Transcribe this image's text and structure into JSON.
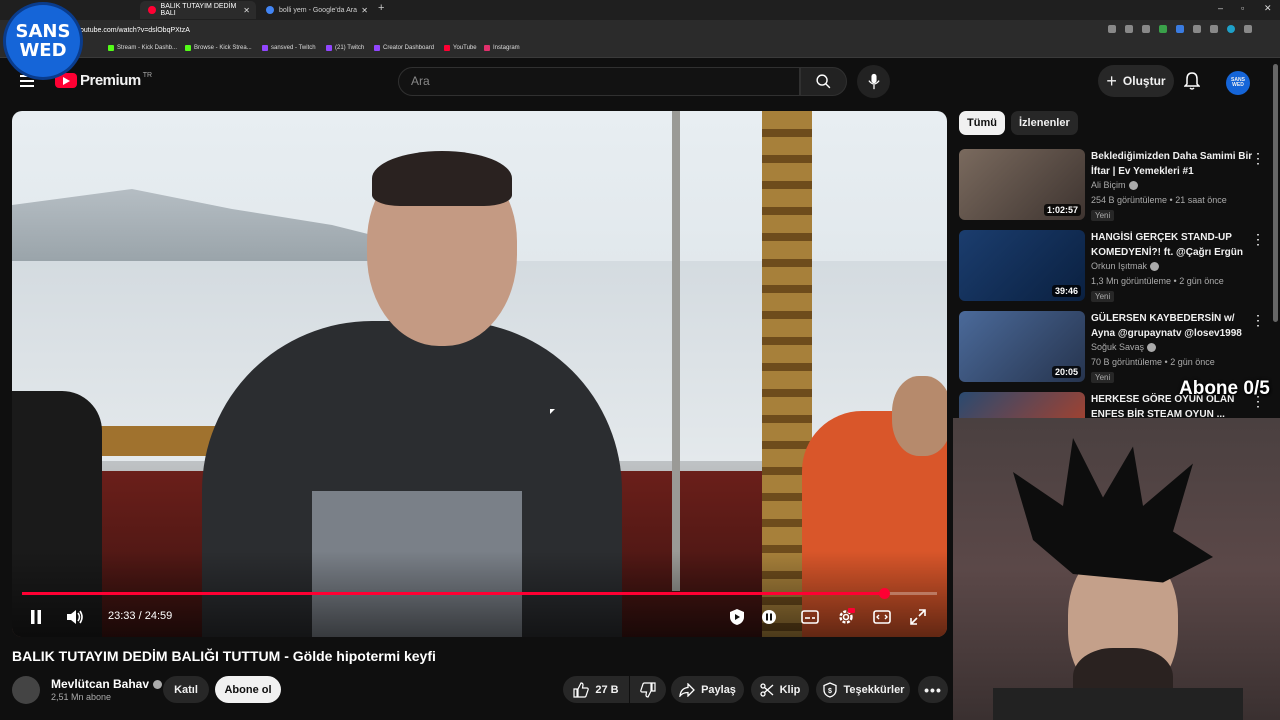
{
  "browser": {
    "tabs": [
      {
        "label": "BALIK TUTAYIM DEDİM BALI",
        "active": true
      },
      {
        "label": "bolli yem - Google'da Ara",
        "active": false
      }
    ],
    "address": "outube.com/watch?v=dslObqPXtzA",
    "bookmarks": [
      {
        "label": "Stream - Kick Dashb..."
      },
      {
        "label": "Browse - Kick Strea..."
      },
      {
        "label": "sansved - Twitch"
      },
      {
        "label": "(21) Twitch"
      },
      {
        "label": "Creator Dashboard"
      },
      {
        "label": "YouTube"
      },
      {
        "label": "Instagram"
      }
    ]
  },
  "overlay": {
    "logo_line1": "SANS",
    "logo_line2": "WED",
    "sub_goal": "Abone 0/5"
  },
  "header": {
    "logo_text": "Premium",
    "region": "TR",
    "search_placeholder": "Ara",
    "create_label": "Oluştur",
    "avatar_text": "SANS WED"
  },
  "player": {
    "current_time": "23:33",
    "duration": "24:59",
    "progress_fraction": 0.942
  },
  "video": {
    "title": "BALIK TUTAYIM DEDİM BALIĞI TUTTUM - Gölde hipotermi keyfi",
    "channel": "Mevlütcan Bahav",
    "subscribers": "2,51 Mn abone",
    "join_label": "Katıl",
    "subscribe_label": "Abone ol",
    "likes": "27 B",
    "share_label": "Paylaş",
    "clip_label": "Klip",
    "thanks_label": "Teşekkürler"
  },
  "sidebar": {
    "chips": [
      {
        "label": "Tümü",
        "selected": true
      },
      {
        "label": "İzlenenler",
        "selected": false
      }
    ],
    "recommendations": [
      {
        "title": "Beklediğimizden Daha Samimi Bir İftar | Ev Yemekleri #1",
        "channel": "Ali Biçim",
        "meta": "254 B görüntüleme • 21 saat önce",
        "badge": "Yeni",
        "duration": "1:02:57",
        "thumb_color": "#6a5a50"
      },
      {
        "title": "HANGİSİ GERÇEK STAND-UP KOMEDYENİ?! ft. @Çağrı Ergün",
        "channel": "Orkun Işıtmak",
        "meta": "1,3 Mn görüntüleme • 2 gün önce",
        "badge": "Yeni",
        "duration": "39:46",
        "thumb_color": "#1b3d6e"
      },
      {
        "title": "GÜLERSEN KAYBEDERSİN w/ Ayna @grupaynatv @losev1998",
        "channel": "Soğuk Savaş",
        "meta": "70 B görüntüleme • 2 gün önce",
        "badge": "Yeni",
        "duration": "20:05",
        "thumb_color": "#3a4f7a"
      },
      {
        "title": "HERKESE GÖRE OYUN OLAN ENFES BİR STEAM OYUN ...",
        "channel": "",
        "meta": "",
        "badge": "",
        "duration": "",
        "thumb_color": "#2a4a70"
      }
    ]
  }
}
